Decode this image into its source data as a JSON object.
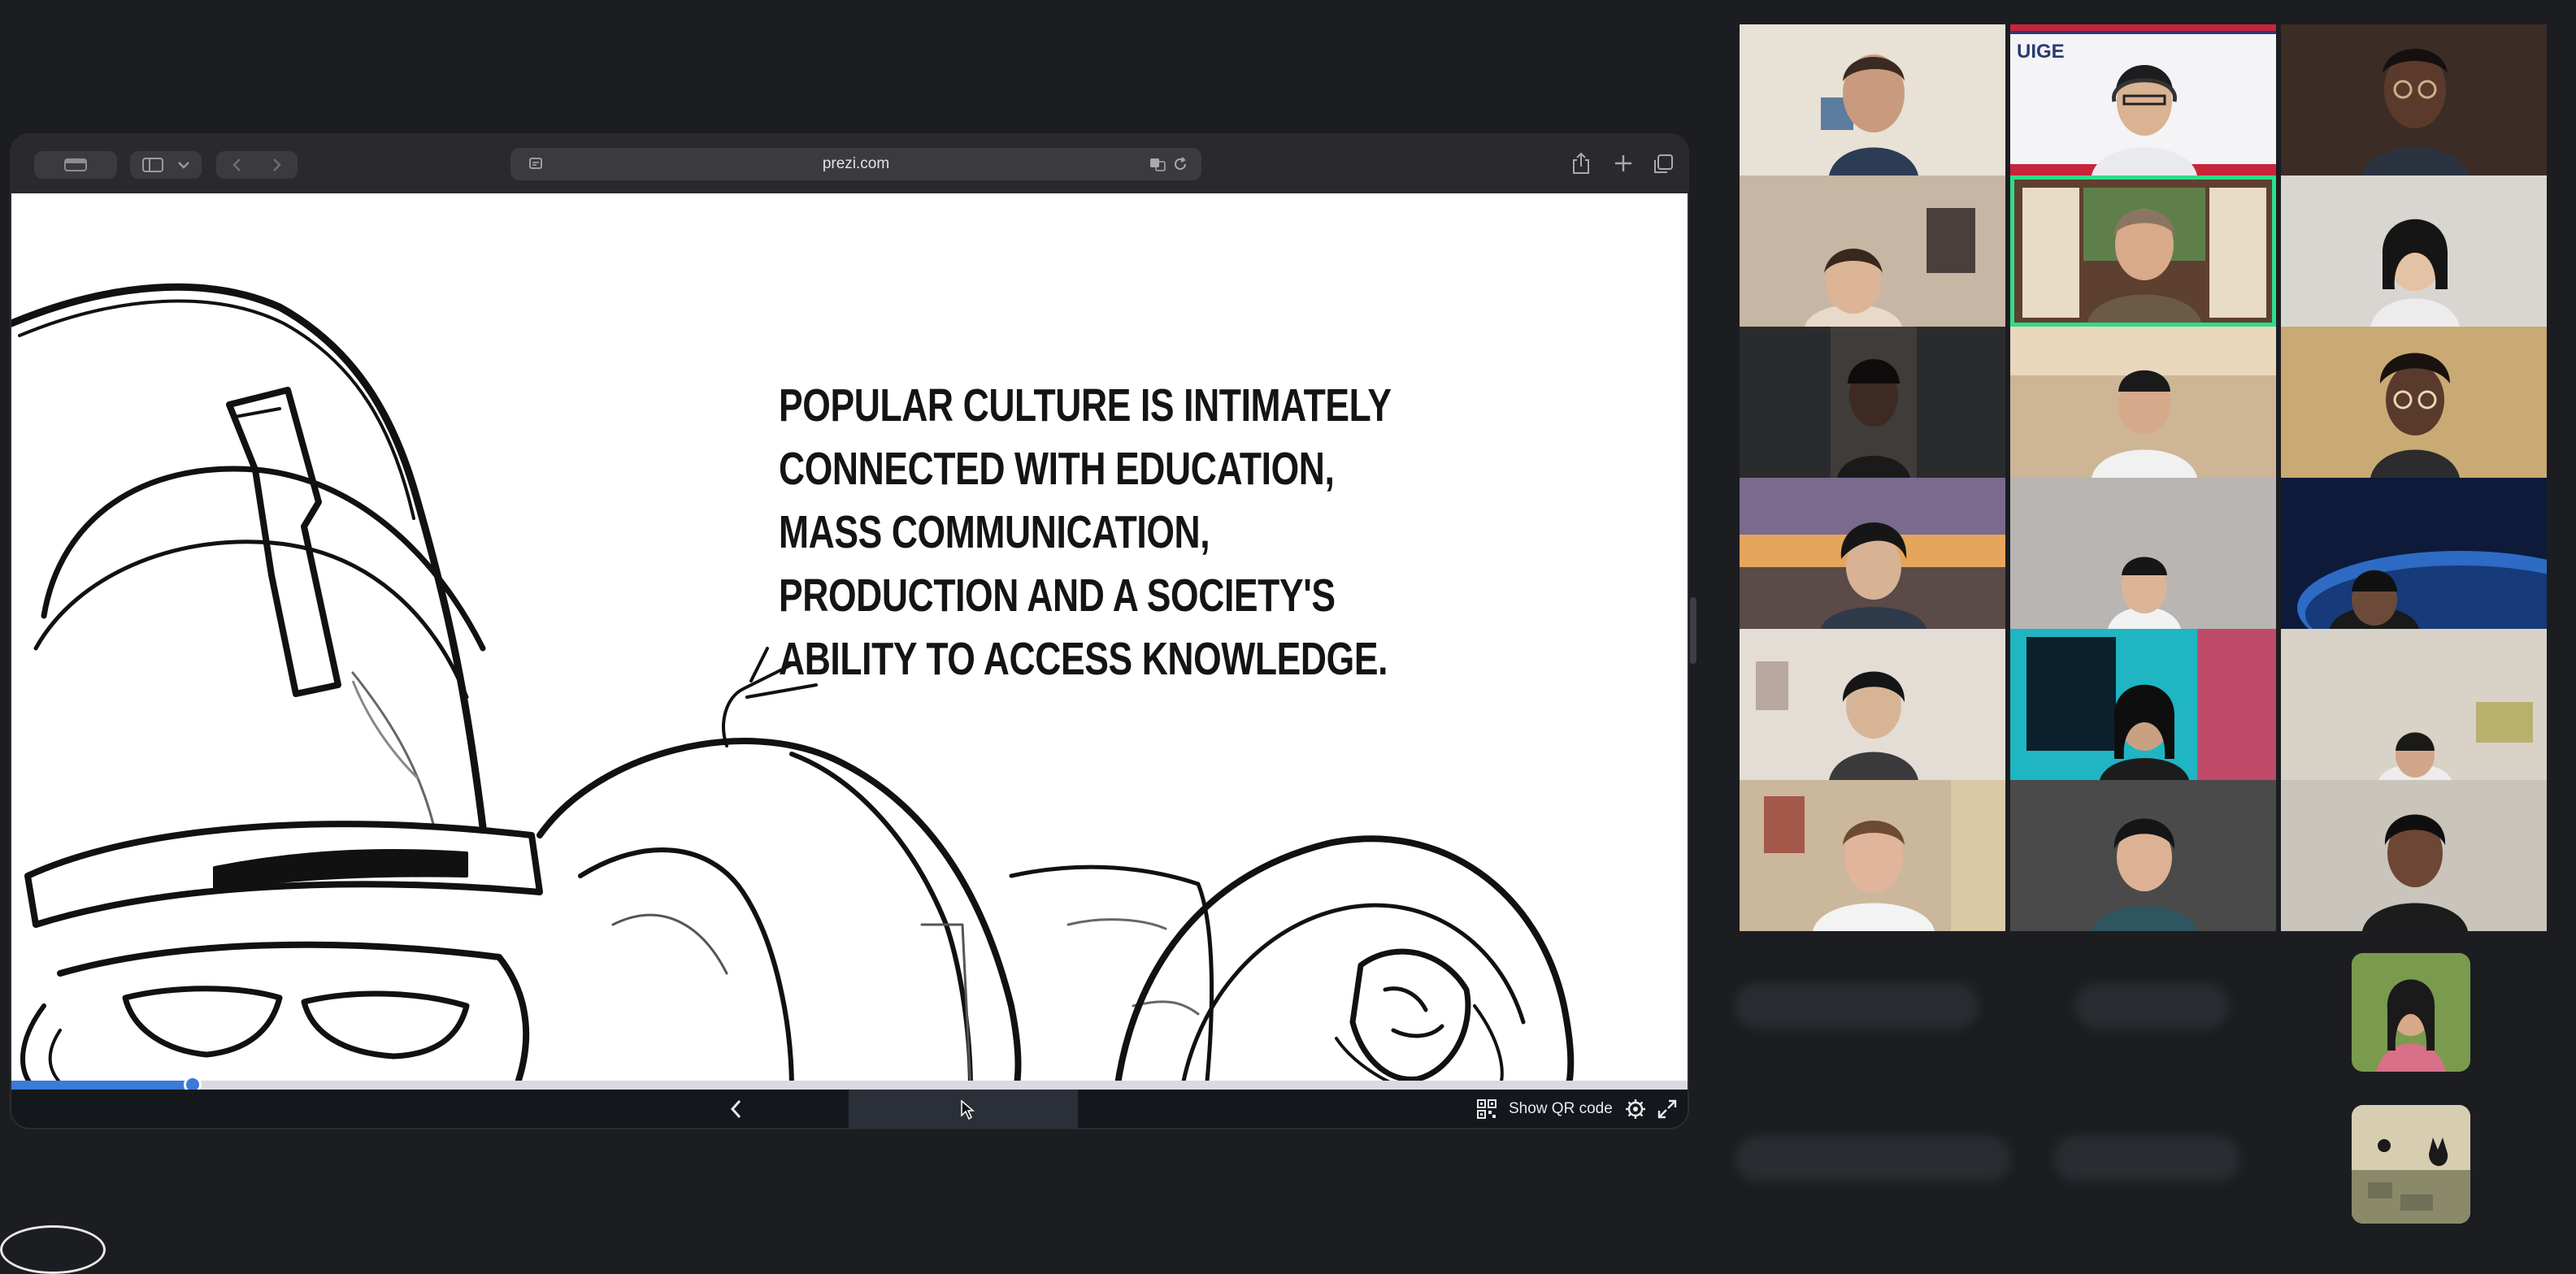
{
  "browser": {
    "address": "prezi.com",
    "icons": {
      "sidebar": "sidebar-icon",
      "back": "chevron-left-icon",
      "forward": "chevron-right-icon",
      "share": "share-icon",
      "new_tab": "plus-icon",
      "tabs": "tabs-overview-icon",
      "translate": "translate-icon",
      "reload": "reload-icon"
    }
  },
  "slide": {
    "lines": [
      "POPULAR CULTURE IS INTIMATELY",
      "CONNECTED WITH EDUCATION,",
      "MASS COMMUNICATION,",
      "PRODUCTION AND A SOCIETY'S",
      "ABILITY TO ACCESS KNOWLEDGE."
    ],
    "progress_fraction": 0.108
  },
  "prezi_controls": {
    "qr_label": "Show QR code",
    "icons": {
      "prev": "chevron-left-icon",
      "qr": "qr-code-icon",
      "settings": "settings-icon",
      "fullscreen": "expand-icon"
    }
  },
  "meeting": {
    "banner_text": "UIGE",
    "active_speaker_color": "#2fdc8b",
    "accent_color": "#3a7bd8"
  }
}
